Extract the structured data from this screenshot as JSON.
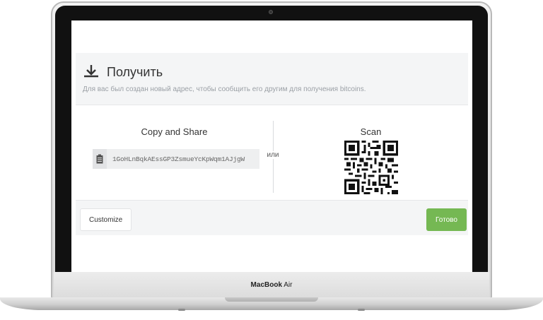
{
  "dialog": {
    "title": "Получить",
    "subtitle": "Для вас был создан новый адрес, чтобы сообщить его другим для получения bitcoins.",
    "copy_title": "Copy and Share",
    "address": "1GoHLnBqkAEssGP3ZsmueYcKpWqm1AJjgW",
    "or_label": "или",
    "scan_title": "Scan",
    "customize_label": "Customize",
    "done_label": "Готово"
  },
  "laptop": {
    "brand_bold": "MacBook",
    "brand_light": " Air"
  },
  "colors": {
    "accent_green": "#75b853",
    "text_dark": "#333333",
    "text_muted": "#9ba0a6"
  },
  "icons": {
    "title_icon": "download-icon",
    "address_icon": "clipboard-icon"
  }
}
